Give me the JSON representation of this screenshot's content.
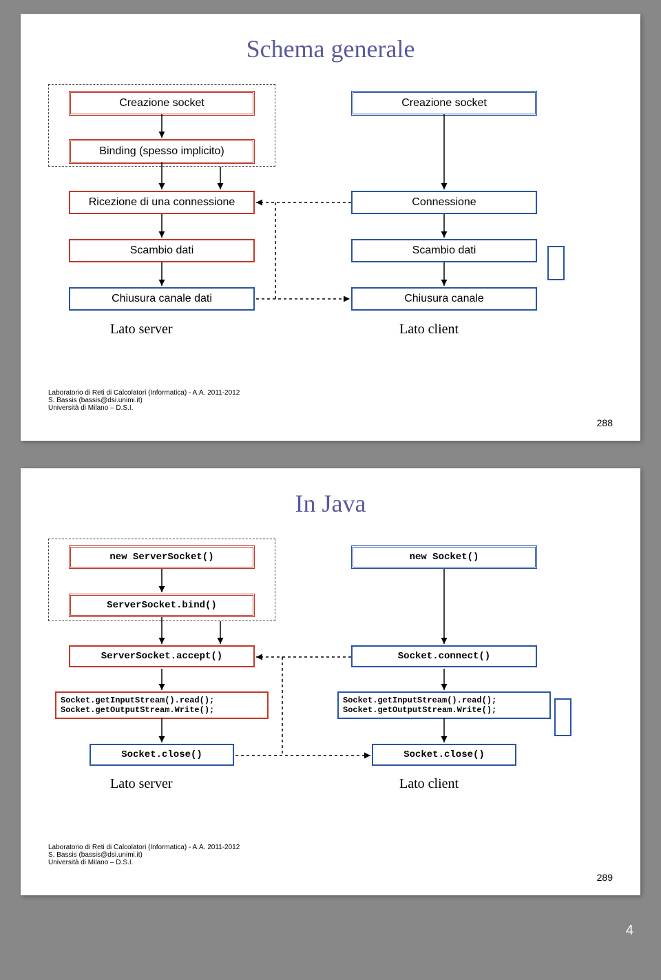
{
  "slide1": {
    "title": "Schema generale",
    "server": {
      "create": "Creazione socket",
      "bind": "Binding (spesso implicito)",
      "accept": "Ricezione di una connessione",
      "exchange": "Scambio dati",
      "close": "Chiusura canale dati",
      "side_label": "Lato server"
    },
    "client": {
      "create": "Creazione socket",
      "connect": "Connessione",
      "exchange": "Scambio dati",
      "close": "Chiusura canale",
      "side_label": "Lato client"
    },
    "footer": {
      "line1": "Laboratorio di Reti di Calcolatori (Informatica) - A.A. 2011-2012",
      "line2": "S. Bassis (bassis@dsi.unimi.it)",
      "line3": "Università di Milano – D.S.I.",
      "page": "288"
    }
  },
  "slide2": {
    "title": "In Java",
    "server": {
      "create": "new ServerSocket()",
      "bind": "ServerSocket.bind()",
      "accept": "ServerSocket.accept()",
      "exchange": "Socket.getInputStream().read();\nSocket.getOutputStream.Write();",
      "close": "Socket.close()",
      "side_label": "Lato server"
    },
    "client": {
      "create": "new Socket()",
      "connect": "Socket.connect()",
      "exchange": "Socket.getInputStream().read();\nSocket.getOutputStream.Write();",
      "close": "Socket.close()",
      "side_label": "Lato client"
    },
    "footer": {
      "line1": "Laboratorio di Reti di Calcolatori (Informatica) - A.A. 2011-2012",
      "line2": "S. Bassis (bassis@dsi.unimi.it)",
      "line3": "Università di Milano – D.S.I.",
      "page": "289"
    }
  },
  "bottom_page": "4",
  "colors": {
    "red": "#c0392b",
    "blue": "#2954a3"
  }
}
